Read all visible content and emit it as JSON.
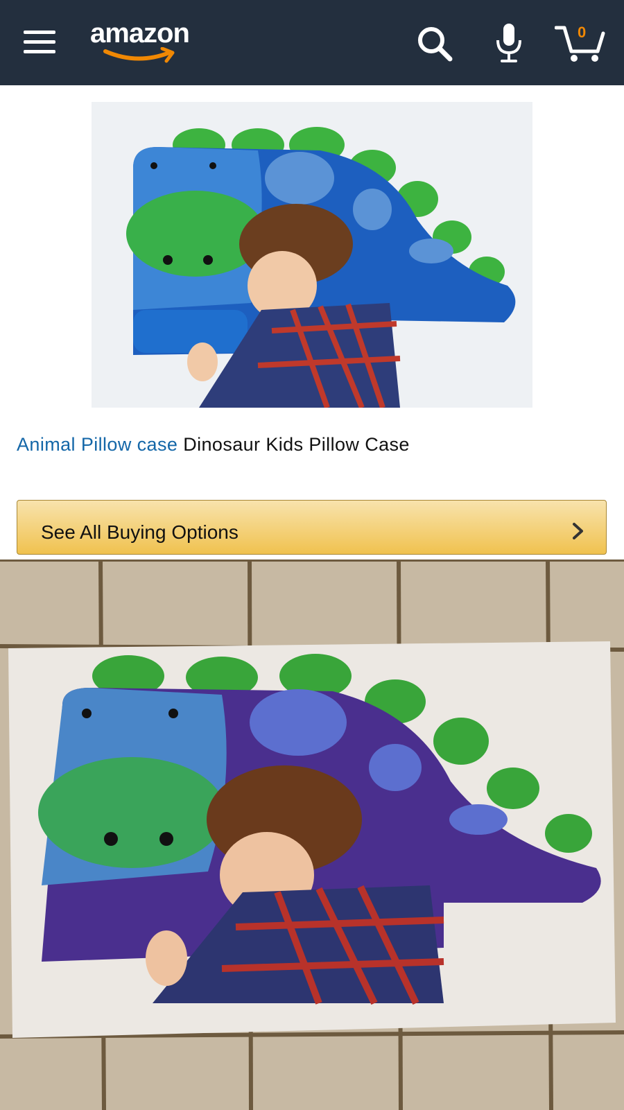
{
  "header": {
    "logo_text": "amazon",
    "menu_icon": "hamburger-icon",
    "search_icon": "search-icon",
    "mic_icon": "microphone-icon",
    "cart_icon": "cart-icon",
    "cart_count": "0",
    "background_color": "#232f3e",
    "accent_color": "#f08804"
  },
  "product": {
    "title_link": "Animal Pillow case",
    "title_text": " Dinosaur Kids Pillow Case",
    "link_color": "#1467a8"
  },
  "buy_button": {
    "label": "See All Buying Options",
    "icon": "chevron-right-icon"
  }
}
